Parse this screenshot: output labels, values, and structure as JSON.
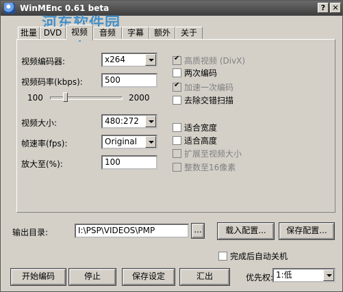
{
  "window": {
    "title": "WinMEnc 0.61 beta"
  },
  "watermark": {
    "text": "河东软件园",
    "url": "www.pc0359.cn"
  },
  "title_buttons": {
    "help": "?",
    "close": "✕"
  },
  "tabs": [
    {
      "label": "批量",
      "active": false
    },
    {
      "label": "DVD",
      "active": false
    },
    {
      "label": "视频",
      "active": true
    },
    {
      "label": "音频",
      "active": false
    },
    {
      "label": "字幕",
      "active": false
    },
    {
      "label": "额外",
      "active": false
    },
    {
      "label": "关于",
      "active": false
    }
  ],
  "video": {
    "encoder_label": "视频编码器:",
    "encoder_value": "x264",
    "bitrate_label": "视频码率(kbps):",
    "bitrate_value": "500",
    "slider_min": "100",
    "slider_max": "2000",
    "slider_fraction": 0.21,
    "size_label": "视频大小:",
    "size_value": "480:272",
    "fps_label": "帧速率(fps):",
    "fps_value": "Original",
    "zoom_label": "放大至(%):",
    "zoom_value": "100"
  },
  "checks": {
    "hq": {
      "label": "高质视频 (DivX)",
      "checked": true,
      "disabled": true
    },
    "twopass": {
      "label": "两次编码",
      "checked": false,
      "disabled": false
    },
    "fastfirst": {
      "label": "加速一次编码",
      "checked": true,
      "disabled": true
    },
    "deinterlace": {
      "label": "去除交错扫描",
      "checked": false,
      "disabled": false
    },
    "fitwidth": {
      "label": "适合宽度",
      "checked": false,
      "disabled": false
    },
    "fitheight": {
      "label": "适合高度",
      "checked": false,
      "disabled": false
    },
    "expand": {
      "label": "扩展至视频大小",
      "checked": false,
      "disabled": true
    },
    "multiple16": {
      "label": "整数至16像素",
      "checked": false,
      "disabled": true
    }
  },
  "output": {
    "label": "输出目录:",
    "path": "I:\\PSP\\VIDEOS\\PMP",
    "browse": "...",
    "load_config": "载入配置...",
    "save_config": "保存配置..."
  },
  "shutdown": {
    "label": "完成后自动关机",
    "checked": false
  },
  "bottom": {
    "start": "开始编码",
    "stop": "停止",
    "save_settings": "保存设定",
    "exit": "汇出",
    "priority_label": "优先权:",
    "priority_value": "1:低"
  }
}
